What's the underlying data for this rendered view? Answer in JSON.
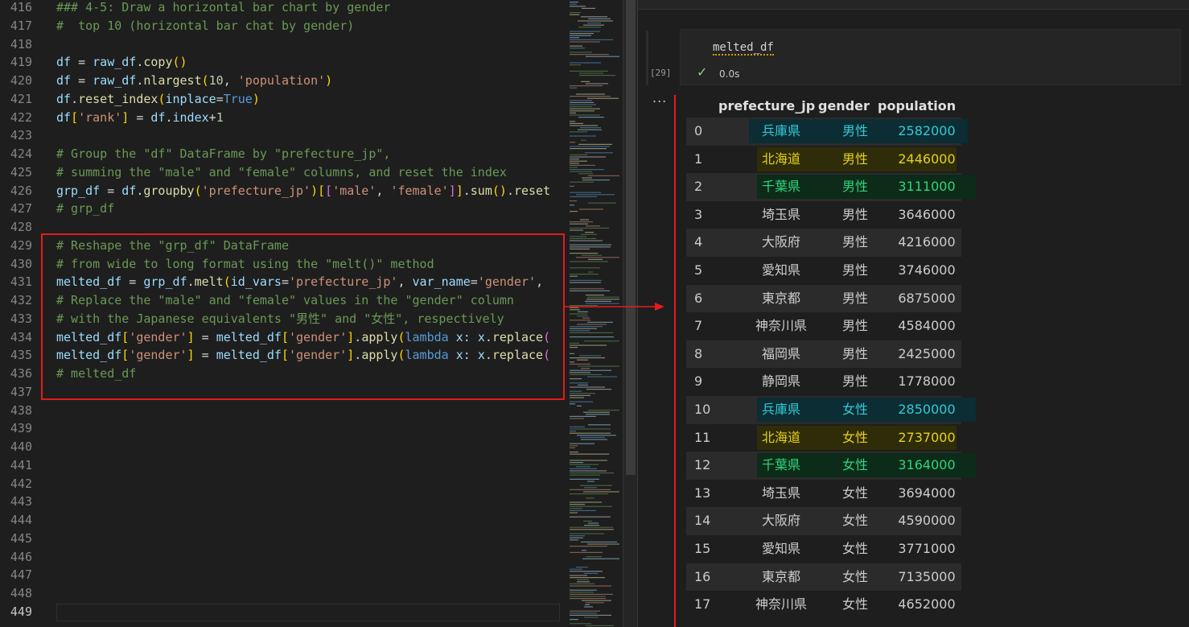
{
  "editor": {
    "lines": [
      {
        "n": "416",
        "tokens": [
          {
            "t": "### 4-5: Draw a horizontal bar chart by gender",
            "c": "cm"
          }
        ]
      },
      {
        "n": "417",
        "tokens": [
          {
            "t": "#  top 10 (horizontal bar chat by gender)",
            "c": "cm"
          }
        ]
      },
      {
        "n": "418",
        "tokens": []
      },
      {
        "n": "419",
        "tokens": [
          {
            "t": "df",
            "c": "vr"
          },
          {
            "t": " = ",
            "c": "op"
          },
          {
            "t": "raw_df",
            "c": "vr"
          },
          {
            "t": ".",
            "c": "op"
          },
          {
            "t": "copy",
            "c": "fn"
          },
          {
            "t": "()",
            "c": "br1"
          }
        ]
      },
      {
        "n": "420",
        "tokens": [
          {
            "t": "df",
            "c": "vr"
          },
          {
            "t": " = ",
            "c": "op"
          },
          {
            "t": "raw_df",
            "c": "vr"
          },
          {
            "t": ".",
            "c": "op"
          },
          {
            "t": "nlargest",
            "c": "fn"
          },
          {
            "t": "(",
            "c": "br1"
          },
          {
            "t": "10",
            "c": "nu"
          },
          {
            "t": ", ",
            "c": "op"
          },
          {
            "t": "'population'",
            "c": "st"
          },
          {
            "t": ")",
            "c": "br1"
          }
        ]
      },
      {
        "n": "421",
        "tokens": [
          {
            "t": "df",
            "c": "vr"
          },
          {
            "t": ".",
            "c": "op"
          },
          {
            "t": "reset_index",
            "c": "fn"
          },
          {
            "t": "(",
            "c": "br1"
          },
          {
            "t": "inplace",
            "c": "vr"
          },
          {
            "t": "=",
            "c": "op"
          },
          {
            "t": "True",
            "c": "kw"
          },
          {
            "t": ")",
            "c": "br1"
          }
        ]
      },
      {
        "n": "422",
        "tokens": [
          {
            "t": "df",
            "c": "vr"
          },
          {
            "t": "[",
            "c": "br1"
          },
          {
            "t": "'rank'",
            "c": "st"
          },
          {
            "t": "]",
            "c": "br1"
          },
          {
            "t": " = ",
            "c": "op"
          },
          {
            "t": "df",
            "c": "vr"
          },
          {
            "t": ".",
            "c": "op"
          },
          {
            "t": "index",
            "c": "vr"
          },
          {
            "t": "+",
            "c": "op"
          },
          {
            "t": "1",
            "c": "nu"
          }
        ]
      },
      {
        "n": "423",
        "tokens": []
      },
      {
        "n": "424",
        "tokens": [
          {
            "t": "# Group the \"df\" DataFrame by \"prefecture_jp\",",
            "c": "cm"
          }
        ]
      },
      {
        "n": "425",
        "tokens": [
          {
            "t": "# summing the \"male\" and \"female\" columns, and reset the index",
            "c": "cm"
          }
        ]
      },
      {
        "n": "426",
        "tokens": [
          {
            "t": "grp_df",
            "c": "vr"
          },
          {
            "t": " = ",
            "c": "op"
          },
          {
            "t": "df",
            "c": "vr"
          },
          {
            "t": ".",
            "c": "op"
          },
          {
            "t": "groupby",
            "c": "fn"
          },
          {
            "t": "(",
            "c": "br1"
          },
          {
            "t": "'prefecture_jp'",
            "c": "st"
          },
          {
            "t": ")",
            "c": "br1"
          },
          {
            "t": "[",
            "c": "br1"
          },
          {
            "t": "[",
            "c": "br2"
          },
          {
            "t": "'male'",
            "c": "st"
          },
          {
            "t": ", ",
            "c": "op"
          },
          {
            "t": "'female'",
            "c": "st"
          },
          {
            "t": "]",
            "c": "br2"
          },
          {
            "t": "]",
            "c": "br1"
          },
          {
            "t": ".",
            "c": "op"
          },
          {
            "t": "sum",
            "c": "fn"
          },
          {
            "t": "()",
            "c": "br1"
          },
          {
            "t": ".",
            "c": "op"
          },
          {
            "t": "reset",
            "c": "fn"
          }
        ]
      },
      {
        "n": "427",
        "tokens": [
          {
            "t": "# grp_df",
            "c": "cm"
          }
        ]
      },
      {
        "n": "428",
        "tokens": []
      },
      {
        "n": "429",
        "tokens": [
          {
            "t": "# Reshape the \"grp_df\" DataFrame",
            "c": "cm"
          }
        ]
      },
      {
        "n": "430",
        "tokens": [
          {
            "t": "# from wide to long format using the \"melt()\" method",
            "c": "cm"
          }
        ]
      },
      {
        "n": "431",
        "tokens": [
          {
            "t": "melted_df",
            "c": "vr"
          },
          {
            "t": " = ",
            "c": "op"
          },
          {
            "t": "grp_df",
            "c": "vr"
          },
          {
            "t": ".",
            "c": "op"
          },
          {
            "t": "melt",
            "c": "fn"
          },
          {
            "t": "(",
            "c": "br1"
          },
          {
            "t": "id_vars",
            "c": "vr"
          },
          {
            "t": "=",
            "c": "op"
          },
          {
            "t": "'prefecture_jp'",
            "c": "st"
          },
          {
            "t": ", ",
            "c": "op"
          },
          {
            "t": "var_name",
            "c": "vr"
          },
          {
            "t": "=",
            "c": "op"
          },
          {
            "t": "'gender'",
            "c": "st"
          },
          {
            "t": ",",
            "c": "op"
          }
        ]
      },
      {
        "n": "432",
        "tokens": [
          {
            "t": "# Replace the \"male\" and \"female\" values in the \"gender\" column",
            "c": "cm"
          }
        ]
      },
      {
        "n": "433",
        "tokens": [
          {
            "t": "# with the Japanese equivalents \"男性\" and \"女性\", respectively",
            "c": "cm"
          }
        ]
      },
      {
        "n": "434",
        "tokens": [
          {
            "t": "melted_df",
            "c": "vr"
          },
          {
            "t": "[",
            "c": "br1"
          },
          {
            "t": "'gender'",
            "c": "st"
          },
          {
            "t": "]",
            "c": "br1"
          },
          {
            "t": " = ",
            "c": "op"
          },
          {
            "t": "melted_df",
            "c": "vr"
          },
          {
            "t": "[",
            "c": "br1"
          },
          {
            "t": "'gender'",
            "c": "st"
          },
          {
            "t": "]",
            "c": "br1"
          },
          {
            "t": ".",
            "c": "op"
          },
          {
            "t": "apply",
            "c": "fn"
          },
          {
            "t": "(",
            "c": "br1"
          },
          {
            "t": "lambda",
            "c": "kw"
          },
          {
            "t": " x: ",
            "c": "vr"
          },
          {
            "t": "x",
            "c": "vr"
          },
          {
            "t": ".",
            "c": "op"
          },
          {
            "t": "replace",
            "c": "fn"
          },
          {
            "t": "(",
            "c": "br2"
          }
        ]
      },
      {
        "n": "435",
        "tokens": [
          {
            "t": "melted_df",
            "c": "vr"
          },
          {
            "t": "[",
            "c": "br1"
          },
          {
            "t": "'gender'",
            "c": "st"
          },
          {
            "t": "]",
            "c": "br1"
          },
          {
            "t": " = ",
            "c": "op"
          },
          {
            "t": "melted_df",
            "c": "vr"
          },
          {
            "t": "[",
            "c": "br1"
          },
          {
            "t": "'gender'",
            "c": "st"
          },
          {
            "t": "]",
            "c": "br1"
          },
          {
            "t": ".",
            "c": "op"
          },
          {
            "t": "apply",
            "c": "fn"
          },
          {
            "t": "(",
            "c": "br1"
          },
          {
            "t": "lambda",
            "c": "kw"
          },
          {
            "t": " x: ",
            "c": "vr"
          },
          {
            "t": "x",
            "c": "vr"
          },
          {
            "t": ".",
            "c": "op"
          },
          {
            "t": "replace",
            "c": "fn"
          },
          {
            "t": "(",
            "c": "br2"
          }
        ]
      },
      {
        "n": "436",
        "tokens": [
          {
            "t": "# melted_df",
            "c": "cm"
          }
        ]
      },
      {
        "n": "437",
        "tokens": []
      },
      {
        "n": "438",
        "tokens": []
      },
      {
        "n": "439",
        "tokens": []
      },
      {
        "n": "440",
        "tokens": []
      },
      {
        "n": "441",
        "tokens": []
      },
      {
        "n": "442",
        "tokens": []
      },
      {
        "n": "443",
        "tokens": []
      },
      {
        "n": "444",
        "tokens": []
      },
      {
        "n": "445",
        "tokens": []
      },
      {
        "n": "446",
        "tokens": []
      },
      {
        "n": "447",
        "tokens": []
      },
      {
        "n": "448",
        "tokens": []
      },
      {
        "n": "449",
        "tokens": [],
        "active": true
      }
    ]
  },
  "cell": {
    "code": "melted_df",
    "exec_count": "[29]",
    "status_icon": "check-icon",
    "exec_time": "0.0s",
    "output_menu": "..."
  },
  "table": {
    "columns": [
      "prefecture_jp",
      "gender",
      "population"
    ],
    "rows": [
      {
        "idx": "0",
        "pref": "兵庫県",
        "gender": "男性",
        "pop": "2582000",
        "hl": "cyan"
      },
      {
        "idx": "1",
        "pref": "北海道",
        "gender": "男性",
        "pop": "2446000",
        "hl": "yellow"
      },
      {
        "idx": "2",
        "pref": "千葉県",
        "gender": "男性",
        "pop": "3111000",
        "hl": "green"
      },
      {
        "idx": "3",
        "pref": "埼玉県",
        "gender": "男性",
        "pop": "3646000"
      },
      {
        "idx": "4",
        "pref": "大阪府",
        "gender": "男性",
        "pop": "4216000"
      },
      {
        "idx": "5",
        "pref": "愛知県",
        "gender": "男性",
        "pop": "3746000"
      },
      {
        "idx": "6",
        "pref": "東京都",
        "gender": "男性",
        "pop": "6875000"
      },
      {
        "idx": "7",
        "pref": "神奈川県",
        "gender": "男性",
        "pop": "4584000"
      },
      {
        "idx": "8",
        "pref": "福岡県",
        "gender": "男性",
        "pop": "2425000"
      },
      {
        "idx": "9",
        "pref": "静岡県",
        "gender": "男性",
        "pop": "1778000"
      },
      {
        "idx": "10",
        "pref": "兵庫県",
        "gender": "女性",
        "pop": "2850000",
        "hl": "cyan"
      },
      {
        "idx": "11",
        "pref": "北海道",
        "gender": "女性",
        "pop": "2737000",
        "hl": "yellow"
      },
      {
        "idx": "12",
        "pref": "千葉県",
        "gender": "女性",
        "pop": "3164000",
        "hl": "green"
      },
      {
        "idx": "13",
        "pref": "埼玉県",
        "gender": "女性",
        "pop": "3694000"
      },
      {
        "idx": "14",
        "pref": "大阪府",
        "gender": "女性",
        "pop": "4590000"
      },
      {
        "idx": "15",
        "pref": "愛知県",
        "gender": "女性",
        "pop": "3771000"
      },
      {
        "idx": "16",
        "pref": "東京都",
        "gender": "女性",
        "pop": "7135000"
      },
      {
        "idx": "17",
        "pref": "神奈川県",
        "gender": "女性",
        "pop": "4652000"
      }
    ]
  },
  "colors": {
    "annotation_red": "#e51b1b",
    "hl_cyan_text": "#35c9d6",
    "hl_cyan_bg": "#0b2d33",
    "hl_yellow_text": "#e6d21a",
    "hl_yellow_bg": "#2f2c09",
    "hl_green_text": "#2fd67a",
    "hl_green_bg": "#0c2b19"
  }
}
